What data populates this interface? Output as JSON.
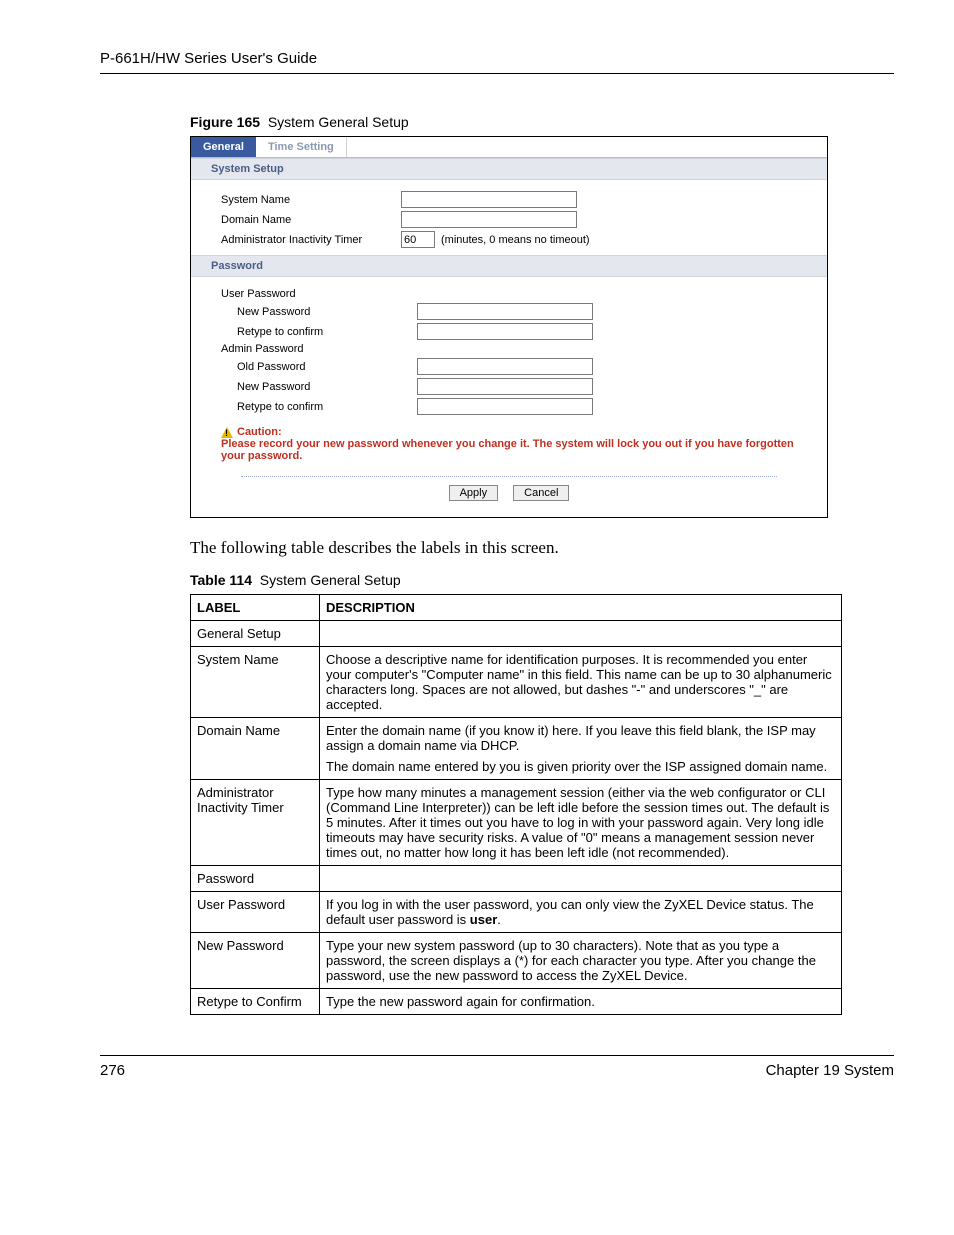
{
  "header": "P-661H/HW Series User's Guide",
  "figure": {
    "num": "Figure 165",
    "title": "System General Setup"
  },
  "ui": {
    "tabs": {
      "general": "General",
      "time": "Time Setting"
    },
    "section_system": "System Setup",
    "labels": {
      "system_name": "System Name",
      "domain_name": "Domain Name",
      "admin_timer": "Administrator Inactivity Timer",
      "timer_hint": "(minutes, 0 means no timeout)"
    },
    "values": {
      "timer": "60"
    },
    "section_password": "Password",
    "pw": {
      "user_pw": "User Password",
      "new_pw": "New Password",
      "retype": "Retype to confirm",
      "admin_pw": "Admin Password",
      "old_pw": "Old Password"
    },
    "caution_label": "Caution:",
    "caution_text": "Please record your new password whenever you change it. The system will lock you out if you have forgotten your password.",
    "btn_apply": "Apply",
    "btn_cancel": "Cancel"
  },
  "intro": "The following table describes the labels in this screen.",
  "table_cap": {
    "num": "Table 114",
    "title": "System General Setup"
  },
  "th": {
    "label": "LABEL",
    "desc": "DESCRIPTION"
  },
  "rows": {
    "r1": {
      "label": "General Setup",
      "desc": ""
    },
    "r2": {
      "label": "System Name",
      "desc": "Choose a descriptive name for identification purposes. It is recommended you enter your computer's \"Computer name\" in this field. This name can be up to 30 alphanumeric characters long. Spaces are not allowed, but dashes \"-\" and underscores \"_\" are accepted."
    },
    "r3": {
      "label": "Domain Name",
      "p1": "Enter the domain name (if you know it) here. If you leave this field blank, the ISP may assign a domain name via DHCP.",
      "p2": "The domain name entered by you is given priority over the ISP assigned domain name."
    },
    "r4": {
      "label": "Administrator Inactivity Timer",
      "desc": "Type how many minutes a management session (either via the web configurator or CLI (Command Line Interpreter)) can be left idle before the session times out. The default is 5 minutes. After it times out you have to log in with your password again. Very long idle timeouts may have security risks. A value of \"0\" means a management session never times out, no matter how long it has been left idle (not recommended)."
    },
    "r5": {
      "label": "Password",
      "desc": ""
    },
    "r6": {
      "label": "User Password",
      "p1": "If you log in with the user password, you can only view the ZyXEL Device status. The default user password is ",
      "bold": "user",
      "p2": "."
    },
    "r7": {
      "label": "New Password",
      "desc": "Type your new system password (up to 30 characters). Note that as you type a password, the screen displays a (*) for each character you type. After you change the password, use the new password to access the ZyXEL Device."
    },
    "r8": {
      "label": "Retype to Confirm",
      "desc": "Type the new password again for confirmation."
    }
  },
  "footer": {
    "page": "276",
    "chapter": "Chapter 19 System"
  }
}
